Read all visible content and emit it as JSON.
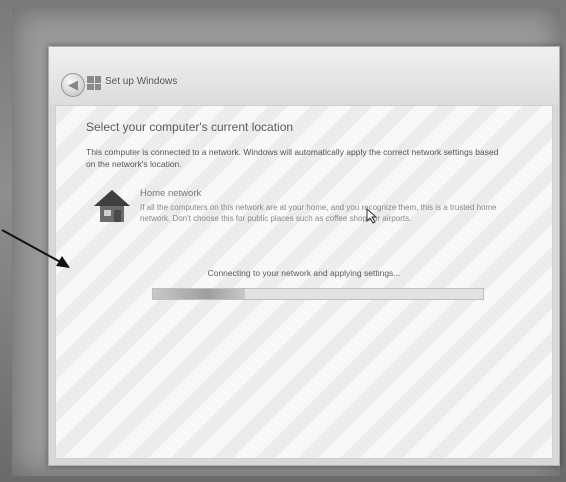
{
  "window": {
    "title": "Set up Windows",
    "back_glyph": "◀"
  },
  "content": {
    "heading": "Select your computer's current location",
    "description": "This computer is connected to a network. Windows will automatically apply the correct network settings based on the network's location.",
    "option": {
      "icon": "house-icon",
      "title": "Home network",
      "description": "If all the computers on this network are at your home, and you recognize them, this is a trusted home network. Don't choose this for public places such as coffee shops or airports."
    },
    "status": "Connecting to your network and applying settings...",
    "progress": 0.28
  },
  "annotation": {
    "icon": "arrow-icon"
  },
  "colors": {
    "background": "#6e6e6e",
    "window": "#d8d8d8",
    "text": "#555555"
  }
}
